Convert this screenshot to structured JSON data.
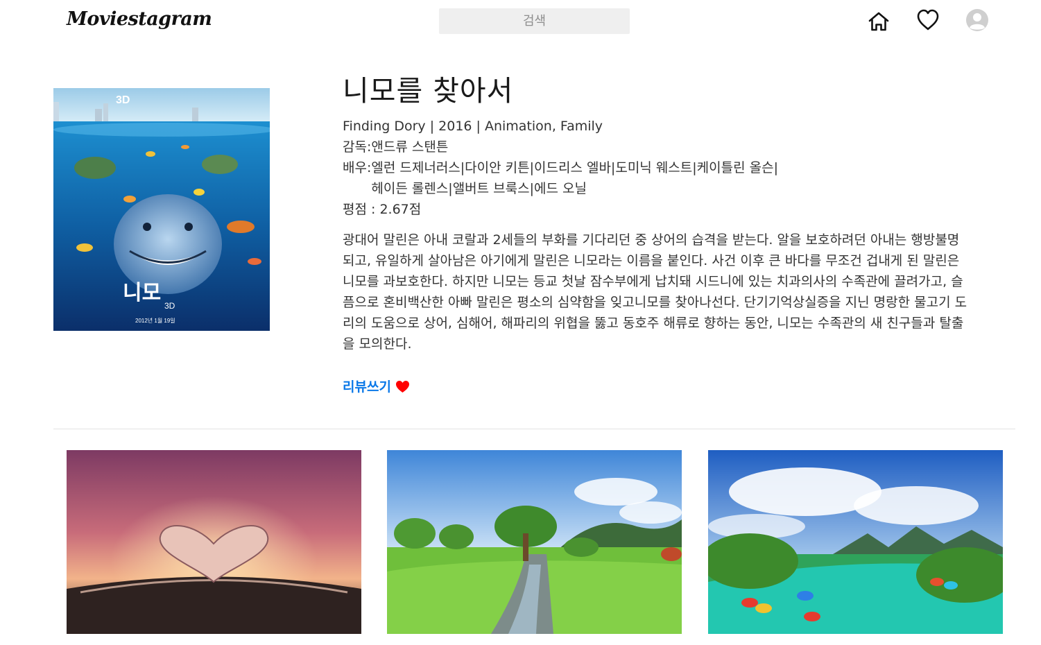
{
  "nav": {
    "logo": "Moviestagram",
    "search_placeholder": "검색",
    "icons": [
      "home-icon",
      "heart-icon",
      "avatar-icon"
    ]
  },
  "movie": {
    "title": "니모를 찾아서",
    "meta": "Finding Dory | 2016 | Animation, Family",
    "director_label": "감독: ",
    "director": "앤드류 스탠튼",
    "cast_label": "배우: ",
    "cast": "엘런 드제너러스|다이안 키튼|이드리스 엘바|도미닉 웨스트|케이틀린 올슨|헤이든 롤렌스|앨버트 브룩스|에드 오닐",
    "rating": "평점 : 2.67점",
    "overview": "광대어 말린은 아내 코랄과 2세들의 부화를 기다리던 중 상어의 습격을 받는다. 알을 보호하려던 아내는 행방불명되고, 유일하게 살아남은 아기에게 말린은 니모라는 이름을 붙인다. 사건 이후 큰 바다를 무조건 겁내게 된 말린은 니모를 과보호한다. 하지만 니모는 등교 첫날 잠수부에게 납치돼 시드니에 있는 치과의사의 수족관에 끌려가고, 슬픔으로 혼비백산한 아빠 말린은 평소의 심약함을 잊고니모를 찾아나선다. 단기기억상실증을 지닌 명랑한 물고기 도리의 도움으로 상어, 심해어, 해파리의 위협을 뚫고 동호주 해류로 향하는 동안, 니모는 수족관의 새 친구들과 탈출을 모의한다.",
    "review_label": "리뷰쓰기"
  },
  "colors": {
    "link": "#0a78e8",
    "heart": "#ff0000",
    "search_bg": "#efefef"
  },
  "thumbnails": [
    {
      "name": "heart-book-sunset-image"
    },
    {
      "name": "stream-meadow-image"
    },
    {
      "name": "river-boats-image"
    }
  ]
}
